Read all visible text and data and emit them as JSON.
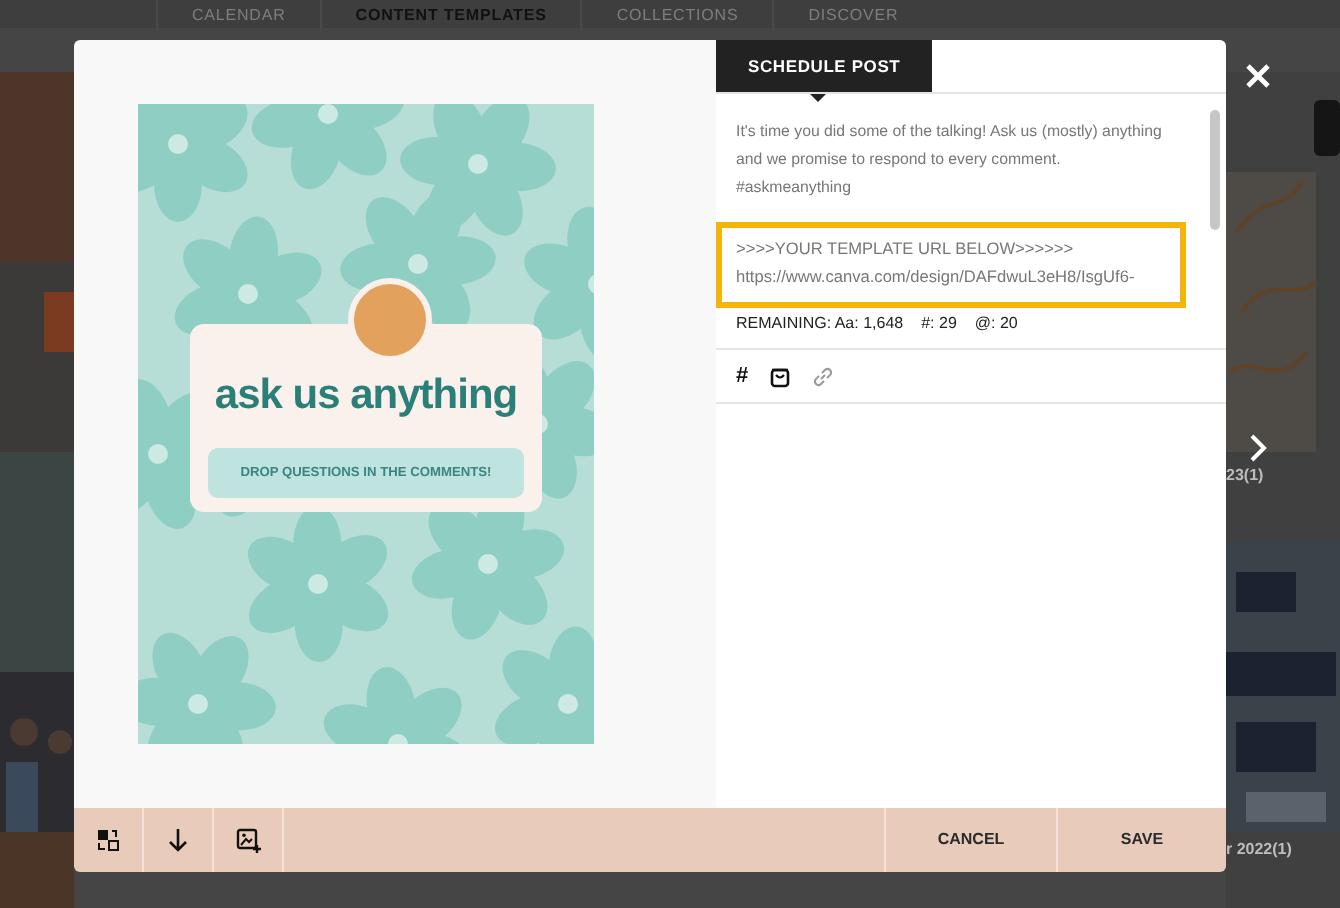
{
  "nav": {
    "tabs": [
      {
        "label": "CALENDAR",
        "selected": false
      },
      {
        "label": "CONTENT TEMPLATES",
        "selected": true
      },
      {
        "label": "COLLECTIONS",
        "selected": false
      },
      {
        "label": "DISCOVER",
        "selected": false
      }
    ]
  },
  "side_captions": [
    "23(1)",
    "r 2022(1)"
  ],
  "modal": {
    "tab": "SCHEDULE POST",
    "preview": {
      "title": "ask us anything",
      "subtitle": "DROP QUESTIONS IN THE COMMENTS!"
    },
    "caption": {
      "text": "It's time you did some of the talking! Ask us (mostly) anything and we promise to respond to every comment. #askmeanything",
      "highlight_lines": [
        ">>>>YOUR TEMPLATE URL BELOW>>>>>>",
        "https://www.canva.com/design/DAFdwuL3eH8/IsgUf6-"
      ]
    },
    "remaining": [
      "REMAINING: Aa: 1,648",
      "#: 29",
      "@: 20"
    ],
    "hashtag_tool": "#",
    "buttons": [
      {
        "label": "CANCEL"
      },
      {
        "label": "SAVE"
      }
    ]
  }
}
